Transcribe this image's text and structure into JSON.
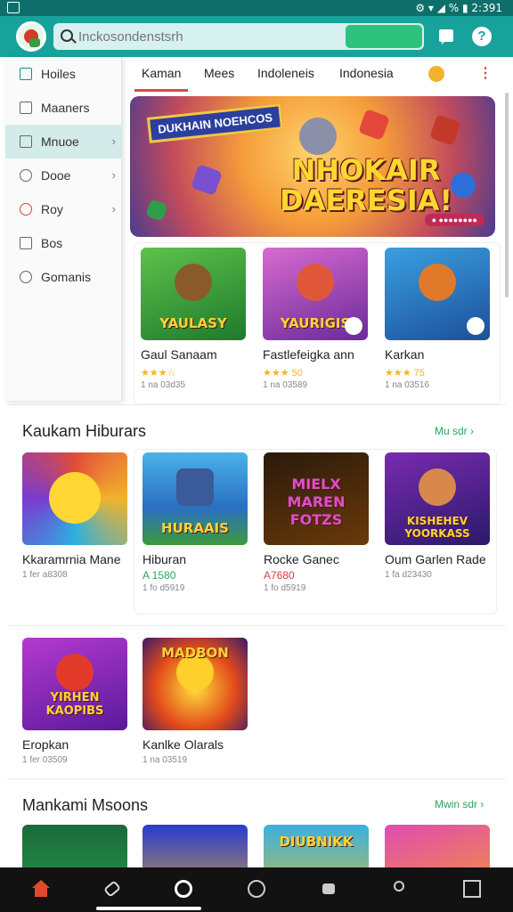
{
  "status_bar": {
    "right_text": "⚙ ▾ ◢ % ▮ 2:391"
  },
  "header": {
    "search_placeholder": "Inckosondenstsrh"
  },
  "sidebar": {
    "items": [
      {
        "label": "Hoiles",
        "icon": "home-icon",
        "chevron": false
      },
      {
        "label": "Maaners",
        "icon": "list-icon",
        "chevron": false
      },
      {
        "label": "Mnuoe",
        "icon": "flag-icon",
        "chevron": true,
        "active": true
      },
      {
        "label": "Dooe",
        "icon": "puzzle-icon",
        "chevron": true
      },
      {
        "label": "Roy",
        "icon": "heart-icon",
        "chevron": true
      },
      {
        "label": "Bos",
        "icon": "tag-icon",
        "chevron": false
      },
      {
        "label": "Gomanis",
        "icon": "circle-icon",
        "chevron": false
      }
    ]
  },
  "tabs": [
    "Kaman",
    "Mees",
    "Indoleneis",
    "Indonesia"
  ],
  "banner": {
    "tag": "DUKHAIN NOEHCOS",
    "title": "NHOKAIR DAERESIA!",
    "pill": "● ●●●●●●●●"
  },
  "featured": [
    {
      "thumb_label": "YAULASY",
      "name": "Gaul Sanaam",
      "stars": "★★★☆",
      "meta": "1 na 03d35"
    },
    {
      "thumb_label": "YAURIGIS",
      "name": "Fastlefeigka ann",
      "stars": "★★★ 50",
      "meta": "1 na 03589"
    },
    {
      "thumb_label": "",
      "name": "Karkan",
      "stars": "★★★ 75",
      "meta": "1 na 03516"
    }
  ],
  "section1": {
    "title": "Kaukam Hiburars",
    "see_all": "Mu sdr ›",
    "cards": [
      {
        "thumb_label": "",
        "name": "Kkaramrnia Mane",
        "price": "",
        "meta": "1 fer a8308"
      },
      {
        "thumb_label": "HURAAIS",
        "name": "Hiburan",
        "price": "A 1580",
        "meta": "1 fo d5919"
      },
      {
        "thumb_label": "MIELX MAREN FOTZS",
        "name": "Rocke Ganec",
        "price": "A7680",
        "meta": "1 fo d5919"
      },
      {
        "thumb_label": "KISHEHEV YOORKASS",
        "name": "Oum Garlen Rade",
        "price": "",
        "meta": "1 fa d23430"
      }
    ]
  },
  "section2": {
    "cards": [
      {
        "thumb_label": "YIRHEN KAOPIBS",
        "name": "Eropkan",
        "meta": "1 fer 03509"
      },
      {
        "thumb_label": "MADBON",
        "name": "Kanlke Olarals",
        "meta": "1 na 03519"
      }
    ]
  },
  "section3": {
    "title": "Mankami Msoons",
    "see_all": "Mwin sdr ›",
    "thumb_labels": [
      "",
      "",
      "DIUBNIKK",
      ""
    ]
  },
  "colors": {
    "teal": "#17a29b",
    "accent_green": "#2aa45c",
    "price_red": "#d93c3c"
  }
}
